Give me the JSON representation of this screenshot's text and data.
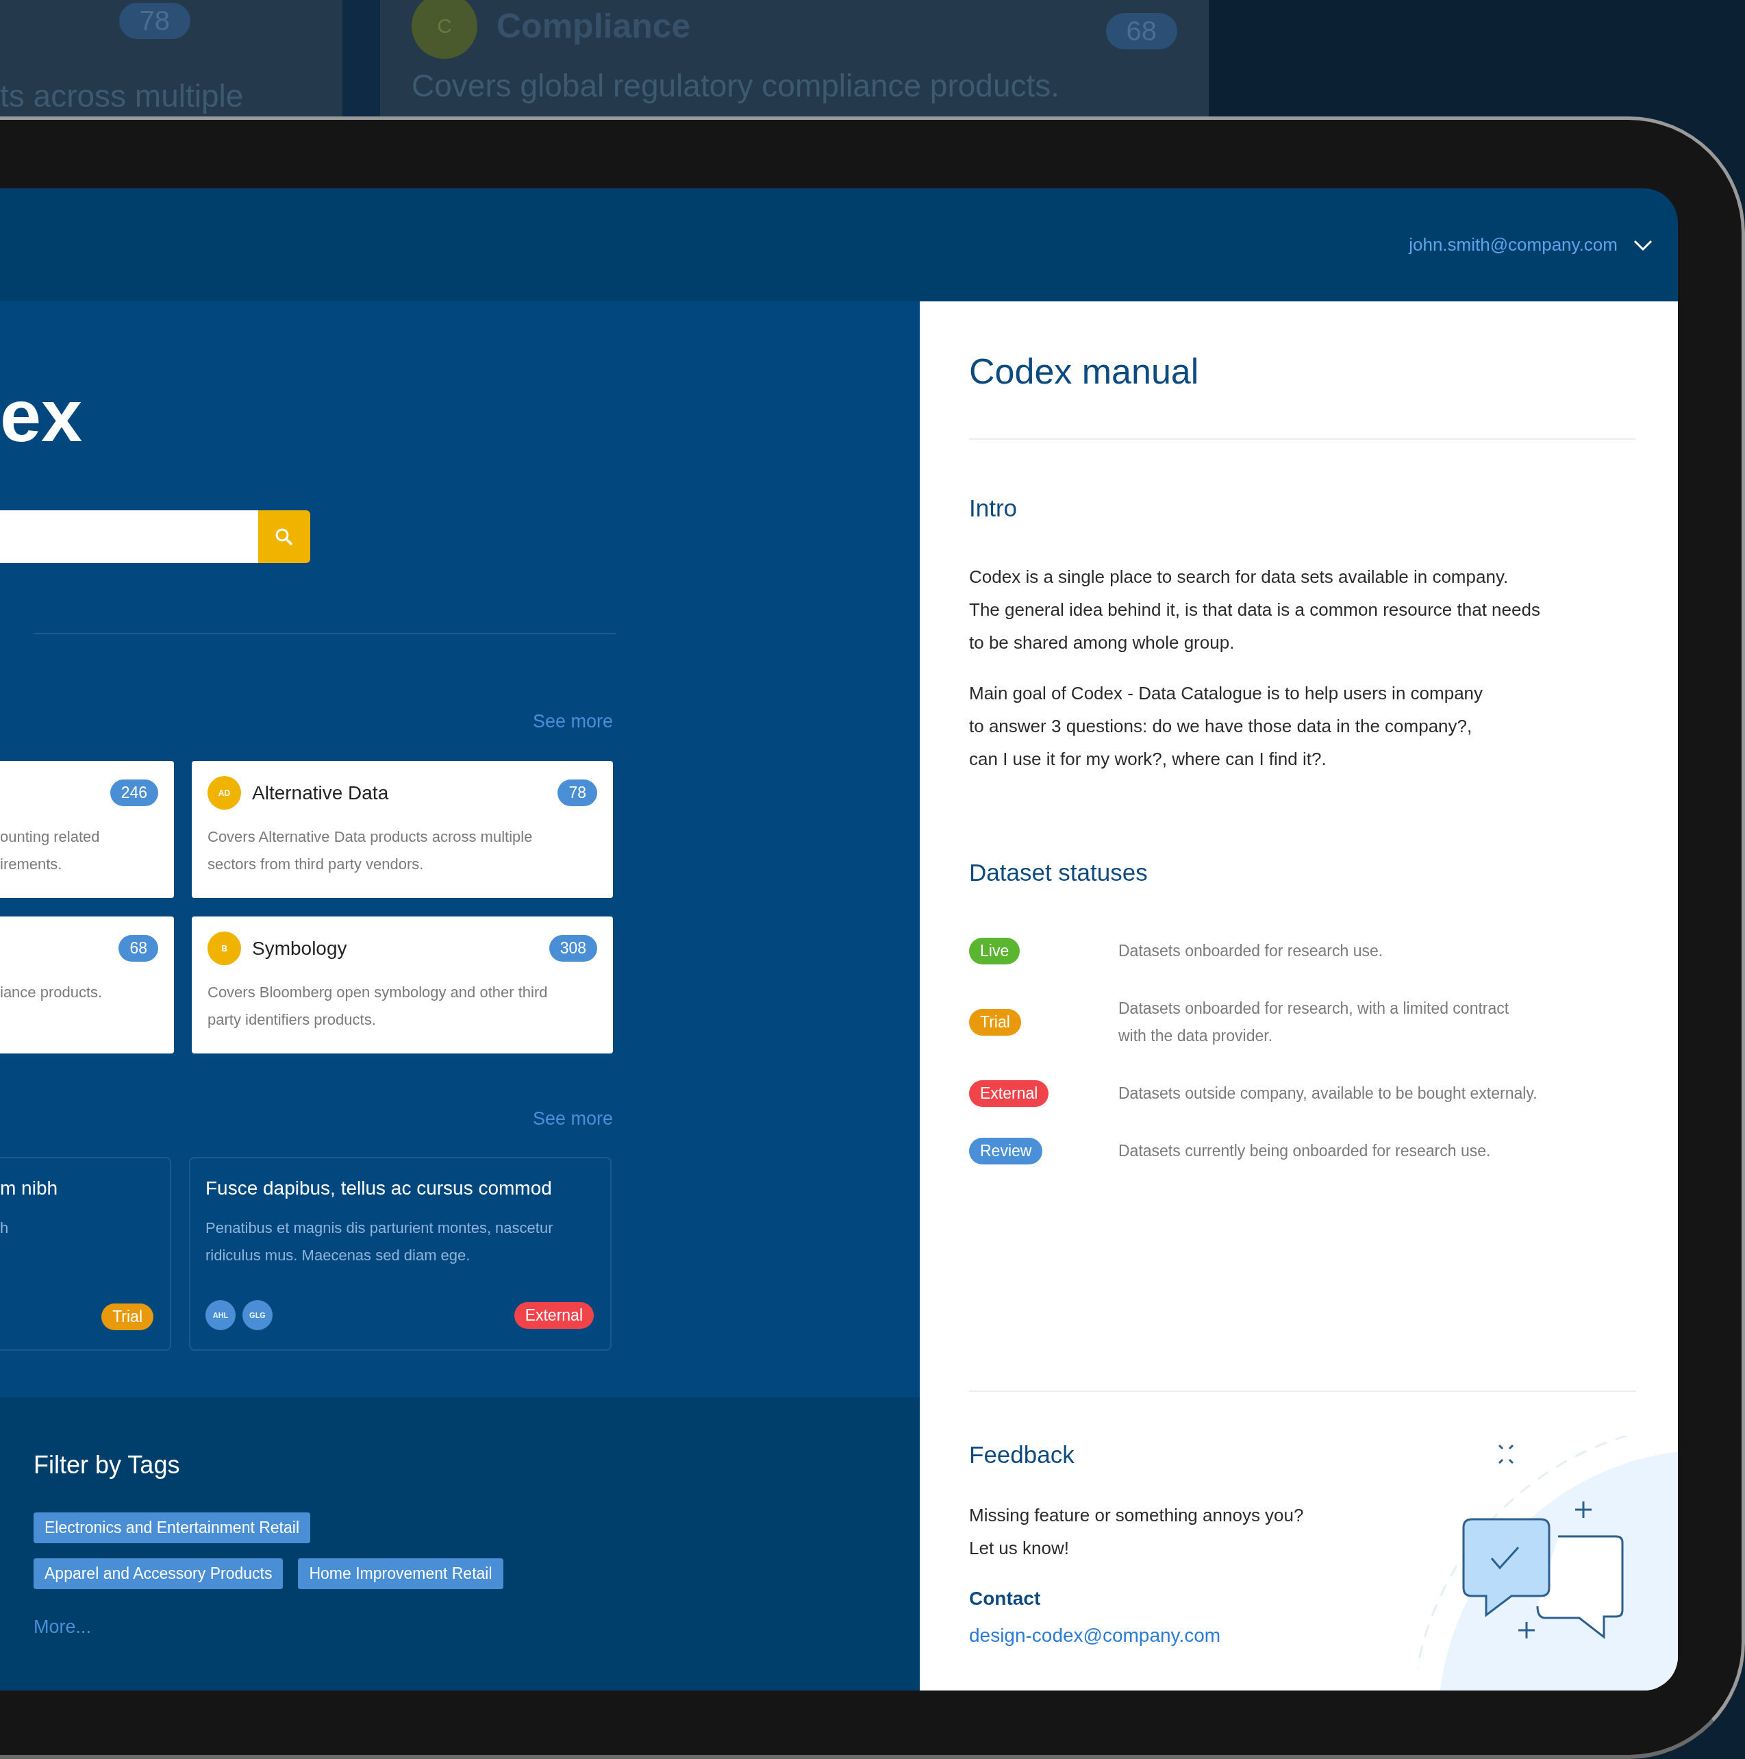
{
  "background": {
    "cards": [
      {
        "count": "78",
        "description": "ts across multiple"
      },
      {
        "avatar": "C",
        "title": "Compliance",
        "count": "68",
        "description": "Covers global regulatory compliance products."
      }
    ]
  },
  "header": {
    "user_email": "john.smith@company.com"
  },
  "main": {
    "title": "ex",
    "categories": {
      "see_more": "See more",
      "cards": [
        {
          "count": "246",
          "description": [
            "ounting related",
            "irements."
          ]
        },
        {
          "avatar": "AD",
          "title": "Alternative Data",
          "count": "78",
          "description": [
            "Covers Alternative Data products across multiple",
            "sectors from third party vendors."
          ]
        },
        {
          "count": "68",
          "description": [
            "iance products."
          ]
        },
        {
          "avatar": "B",
          "title": "Symbology",
          "count": "308",
          "description": [
            "Covers Bloomberg open symbology and other third",
            "party identifiers products."
          ]
        }
      ]
    },
    "datasets": {
      "see_more": "See more",
      "cards": [
        {
          "title": "m nibh",
          "description": [
            "h"
          ],
          "status": {
            "label": "Trial",
            "kind": "trial"
          }
        },
        {
          "title": "Fusce dapibus, tellus ac cursus commod",
          "description": [
            "Penatibus et magnis dis parturient montes, nascetur",
            "ridiculus mus. Maecenas sed diam ege."
          ],
          "tags": [
            "AHL",
            "GLG"
          ],
          "status": {
            "label": "External",
            "kind": "external"
          }
        }
      ]
    }
  },
  "filter": {
    "title": "Filter by Tags",
    "tags": [
      "Electronics and Entertainment Retail",
      "Apparel and Accessory Products",
      "Home Improvement Retail"
    ],
    "more": "More..."
  },
  "manual": {
    "title": "Codex manual",
    "intro": {
      "heading": "Intro",
      "paragraphs": [
        [
          "Codex is a single place to search for data sets available in company.",
          "The general idea behind it, is that data is a common resource that needs",
          "to be shared among whole group."
        ],
        [
          "Main goal of Codex - Data Catalogue is to help users in company",
          "to answer 3 questions: do we have those data in the company?,",
          "can I use it for my work?, where can I find it?."
        ]
      ]
    },
    "statuses": {
      "heading": "Dataset statuses",
      "items": [
        {
          "label": "Live",
          "color": "#5cb531",
          "description": [
            "Datasets onboarded for research use."
          ]
        },
        {
          "label": "Trial",
          "color": "#e89a0c",
          "description": [
            "Datasets onboarded for research, with a limited contract",
            "with the data provider."
          ]
        },
        {
          "label": "External",
          "color": "#f0444a",
          "description": [
            "Datasets outside company, available to be bought externaly."
          ]
        },
        {
          "label": "Review",
          "color": "#4a90d9",
          "description": [
            "Datasets currently being onboarded for research use."
          ]
        }
      ]
    },
    "feedback": {
      "heading": "Feedback",
      "text": [
        "Missing feature or something annoys you?",
        "Let us know!"
      ],
      "contact_label": "Contact",
      "contact_email": "design-codex@company.com"
    }
  }
}
